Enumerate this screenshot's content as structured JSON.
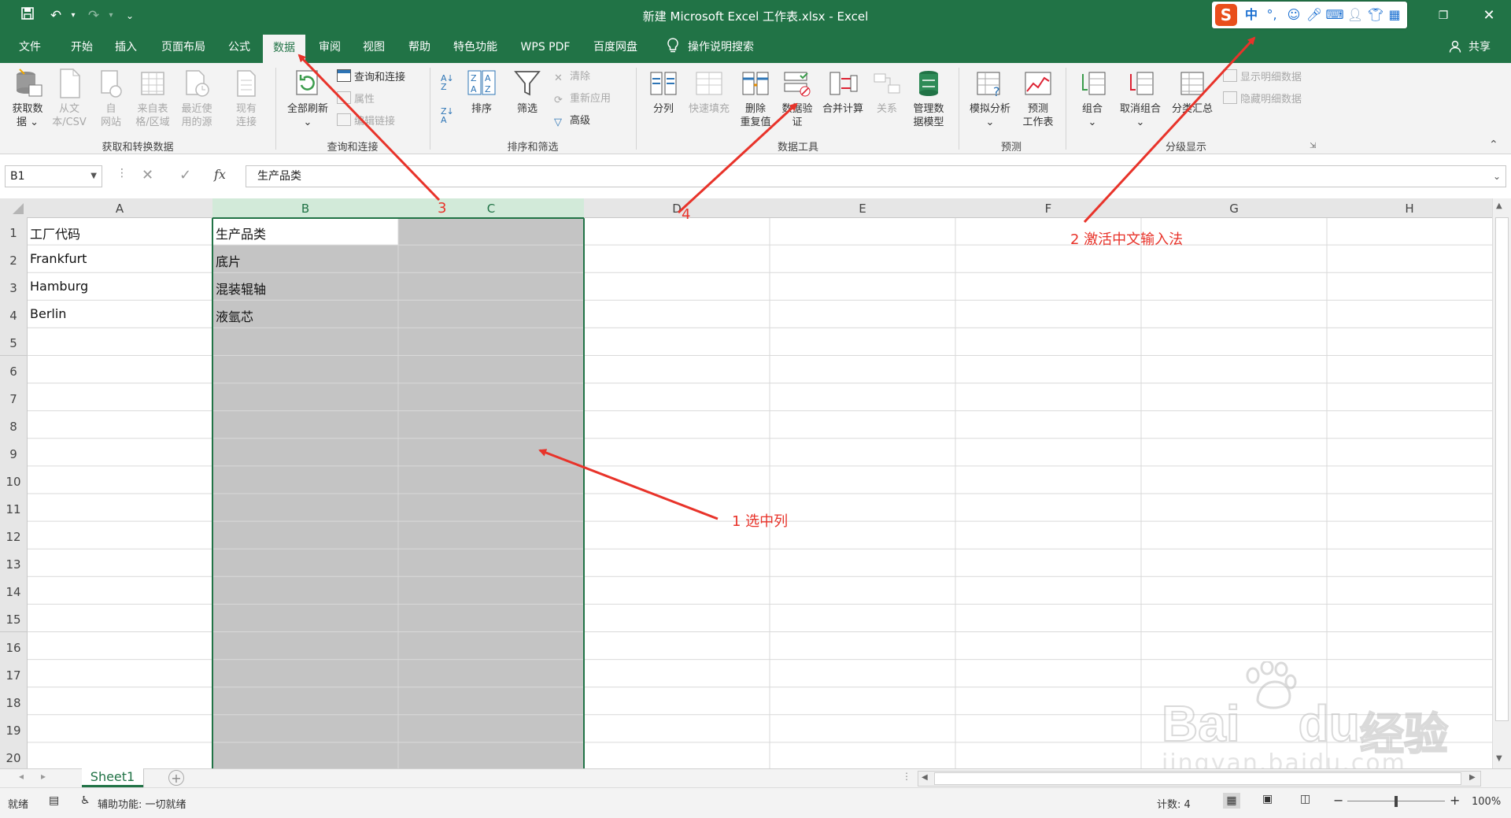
{
  "window": {
    "title": "新建 Microsoft Excel 工作表.xlsx  -  Excel",
    "share_label": "共享"
  },
  "ime": {
    "mode_label": "中",
    "punct_label": "°,"
  },
  "tabs": [
    {
      "label": "文件"
    },
    {
      "label": "开始"
    },
    {
      "label": "插入"
    },
    {
      "label": "页面布局"
    },
    {
      "label": "公式"
    },
    {
      "label": "数据"
    },
    {
      "label": "审阅"
    },
    {
      "label": "视图"
    },
    {
      "label": "帮助"
    },
    {
      "label": "特色功能"
    },
    {
      "label": "WPS PDF"
    },
    {
      "label": "百度网盘"
    }
  ],
  "active_tab": "数据",
  "tell_me": "操作说明搜索",
  "ribbon": {
    "get_data": "获取数\n据",
    "from_csv": "从文\n本/CSV",
    "from_web": "自\n网站",
    "from_table": "来自表\n格/区域",
    "recent_sources": "最近使\n用的源",
    "existing_conn": "现有\n连接",
    "refresh_all": "全部刷新",
    "queries_conn": "查询和连接",
    "properties": "属性",
    "edit_links": "编辑链接",
    "sort": "排序",
    "filter": "筛选",
    "clear": "清除",
    "reapply": "重新应用",
    "advanced": "高级",
    "text_to_cols": "分列",
    "flash_fill": "快速填充",
    "remove_dup": "删除\n重复值",
    "data_validation": "数据验\n证",
    "consolidate": "合并计算",
    "relationships": "关系",
    "manage_model": "管理数\n据模型",
    "what_if": "模拟分析",
    "forecast": "预测\n工作表",
    "group": "组合",
    "ungroup": "取消组合",
    "subtotal": "分类汇总",
    "show_detail": "显示明细数据",
    "hide_detail": "隐藏明细数据",
    "groups": {
      "get_transform": "获取和转换数据",
      "queries": "查询和连接",
      "sort_filter": "排序和筛选",
      "data_tools": "数据工具",
      "forecast": "预测",
      "outline": "分级显示"
    }
  },
  "formula_bar": {
    "name_box": "B1",
    "fx": "fx",
    "content": "生产品类"
  },
  "columns": [
    "A",
    "B",
    "C",
    "D",
    "E",
    "F",
    "G",
    "H"
  ],
  "rows": [
    "1",
    "2",
    "3",
    "4",
    "5",
    "6",
    "7",
    "8",
    "9",
    "10",
    "11",
    "12",
    "13",
    "14",
    "15",
    "16",
    "17",
    "18",
    "19",
    "20"
  ],
  "cells": {
    "A1": "工厂代码",
    "B1": "生产品类",
    "A2": "Frankfurt",
    "B2": "底片",
    "A3": "Hamburg",
    "B3": "混装辊轴",
    "A4": "Berlin",
    "B4": "液氩芯"
  },
  "sheet_tab": "Sheet1",
  "status": {
    "ready": "就绪",
    "accessibility": "辅助功能: 一切就绪",
    "count": "计数: 4",
    "zoom": "100%"
  },
  "annotations": {
    "a1": "1 选中列",
    "a2": "2 激活中文输入法",
    "a3": "3",
    "a4": "4"
  },
  "watermark": {
    "brand": "Bai",
    "brand_tail": "du",
    "cn": "经验",
    "url": "jingyan.baidu.com"
  },
  "colors": {
    "excel_green": "#217346",
    "selection_gray": "#c4c4c4",
    "annotation_red": "#e8332a"
  }
}
